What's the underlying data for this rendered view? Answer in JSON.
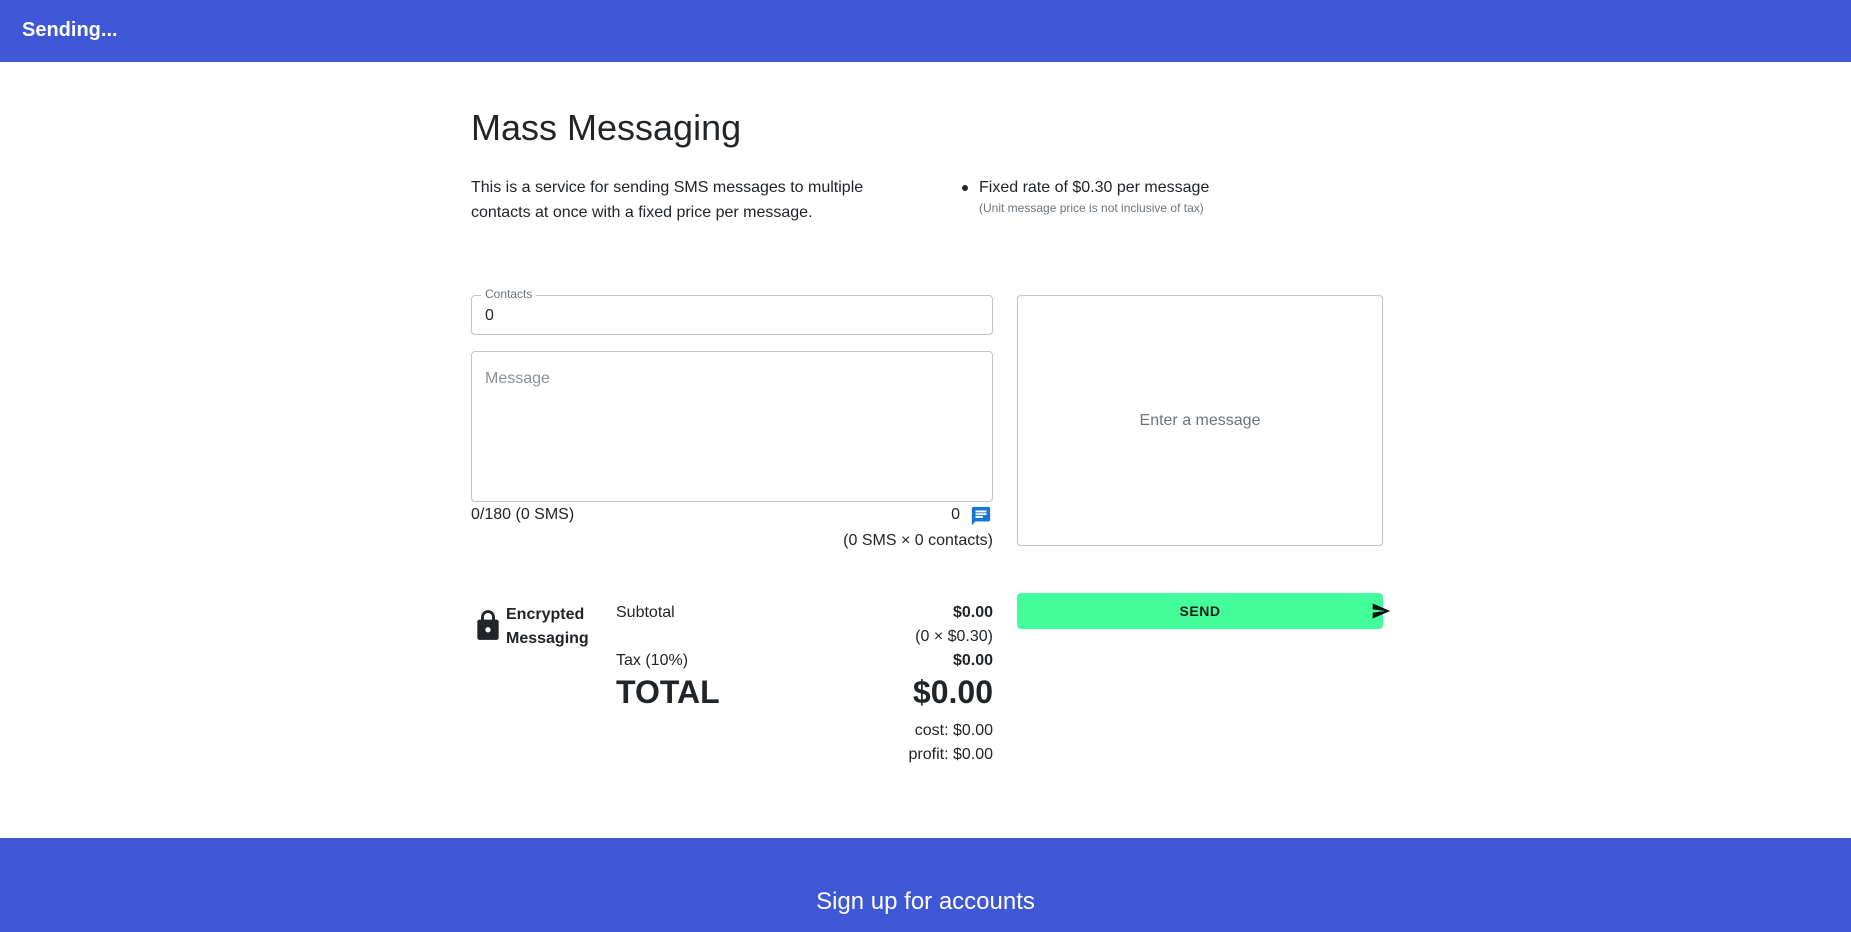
{
  "header": {
    "title": "Sending..."
  },
  "page": {
    "title": "Mass Messaging",
    "intro": "This is a service for sending SMS messages to multiple contacts at once with a fixed price per message.",
    "rate": "Fixed rate of $0.30 per message",
    "rate_note": "(Unit message price is not inclusive of tax)"
  },
  "form": {
    "contacts_label": "Contacts",
    "contacts_value": "0",
    "message_placeholder": "Message",
    "char_count": "0/180 (0 SMS)",
    "message_count": "0",
    "sms_formula": "(0 SMS × 0 contacts)"
  },
  "preview": {
    "placeholder": "Enter a message"
  },
  "security": {
    "label": "Encrypted Messaging"
  },
  "summary": {
    "subtotal_label": "Subtotal",
    "subtotal_value": "$0.00",
    "subtotal_formula": "(0 × $0.30)",
    "tax_label": "Tax (10%)",
    "tax_value": "$0.00",
    "total_label": "TOTAL",
    "total_value": "$0.00",
    "cost": "cost: $0.00",
    "profit": "profit: $0.00"
  },
  "actions": {
    "send_label": "SEND"
  },
  "footer": {
    "title": "Sign up for accounts"
  },
  "icons": {
    "chat": "chat-icon",
    "lock": "lock-icon",
    "send": "send-icon"
  },
  "colors": {
    "brand": "#3d57d6",
    "send_button": "#43fd9b",
    "chat_icon": "#1976d2"
  }
}
